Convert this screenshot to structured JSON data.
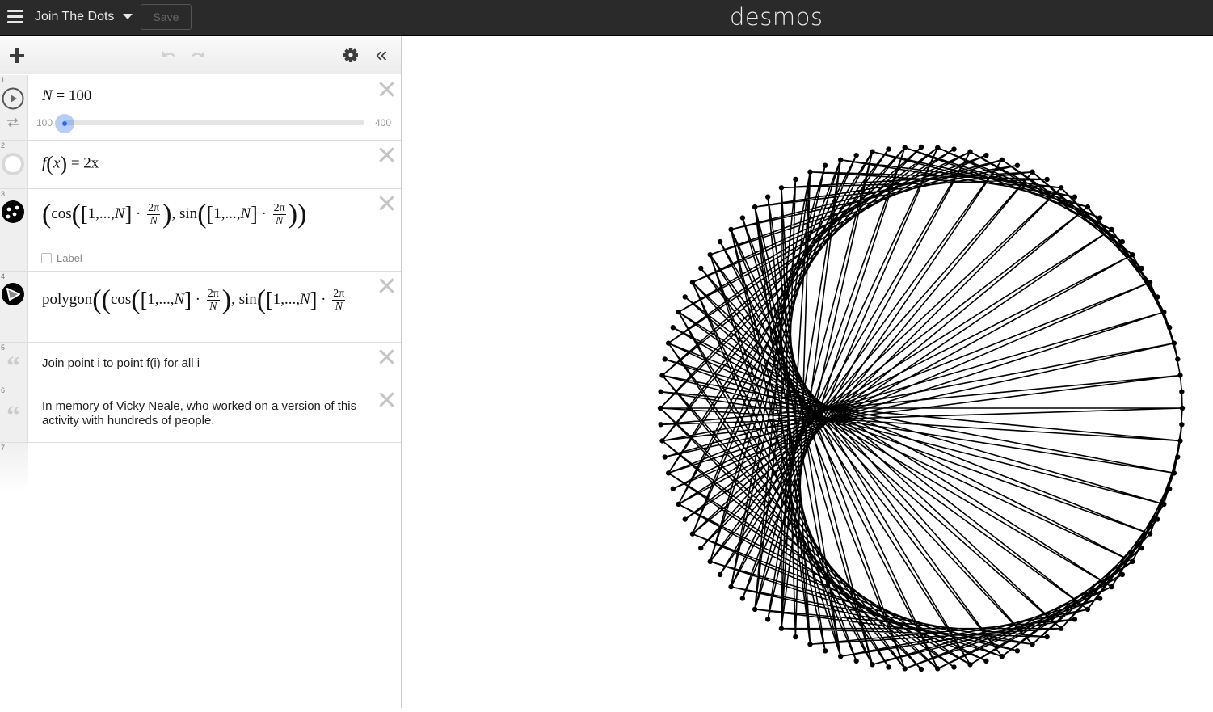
{
  "header": {
    "menu_icon": "hamburger-menu-icon",
    "title": "Join The Dots",
    "title_caret_icon": "caret-down-icon",
    "save_label": "Save",
    "logo": "desmos"
  },
  "toolbar": {
    "add_icon": "plus-icon",
    "undo_icon": "undo-icon",
    "redo_icon": "redo-icon",
    "settings_icon": "gear-icon",
    "collapse_icon": "double-chevron-left-icon",
    "collapse_glyph": "«"
  },
  "expressions": [
    {
      "index": "1",
      "type": "slider",
      "variable": "N",
      "equals": "=",
      "value": "100",
      "slider": {
        "min_label": "100",
        "max_label": "400",
        "min": 100,
        "max": 400,
        "current": 100,
        "accent": "#2d70e6"
      },
      "icons": [
        "play-icon",
        "loop-icon"
      ]
    },
    {
      "index": "2",
      "type": "function",
      "fname": "f",
      "arg": "x",
      "rhs": "2x",
      "icon": "hidden-circle-icon"
    },
    {
      "index": "3",
      "type": "point-list",
      "cos": "cos",
      "sin": "sin",
      "list": "1,...,",
      "list_end": "N",
      "frac_num": "2π",
      "frac_den": "N",
      "dot": "·",
      "label_checkbox": "Label",
      "icon": "points-icon"
    },
    {
      "index": "4",
      "type": "polygon",
      "fn": "polygon",
      "cos": "cos",
      "sin": "sin",
      "list": "1,...,",
      "list_end": "N",
      "frac_num": "2π",
      "frac_den": "N",
      "dot": "·",
      "icon": "polygon-icon"
    },
    {
      "index": "5",
      "type": "note",
      "text": "Join point i to point f(i) for all i",
      "icon": "quote-icon"
    },
    {
      "index": "6",
      "type": "note",
      "text": "In memory of Vicky Neale, who worked on a version of this activity with hundreds of people.",
      "icon": "quote-icon"
    },
    {
      "index": "7",
      "type": "empty"
    }
  ],
  "graph": {
    "N": 100,
    "multiplier": 2,
    "line_color": "#000000",
    "point_color": "#000000"
  }
}
